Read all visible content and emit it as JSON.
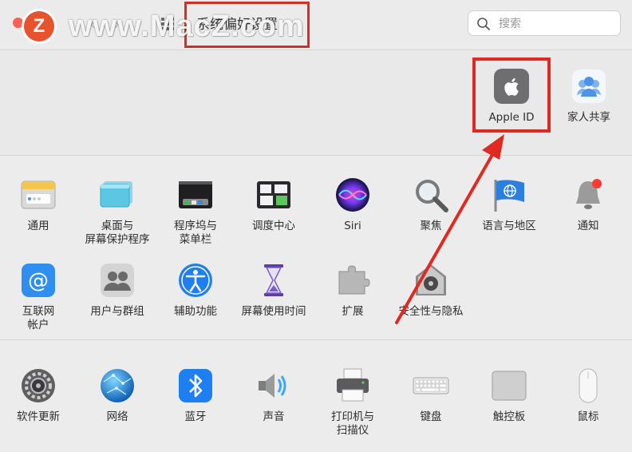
{
  "window": {
    "title": "系统偏好设置",
    "watermark": "www.MacZ.com",
    "brand_letter": "Z"
  },
  "search": {
    "placeholder": "搜索",
    "value": ""
  },
  "account": [
    {
      "id": "apple-id",
      "label": "Apple ID",
      "icon": "apple-logo-icon"
    },
    {
      "id": "family-sharing",
      "label": "家人共享",
      "icon": "family-sharing-icon"
    }
  ],
  "panes_row1": [
    {
      "id": "general",
      "label": "通用",
      "icon": "general-icon"
    },
    {
      "id": "desktop-screensaver",
      "label": "桌面与\n屏幕保护程序",
      "icon": "desktop-icon"
    },
    {
      "id": "dock-menubar",
      "label": "程序坞与\n菜单栏",
      "icon": "dock-icon"
    },
    {
      "id": "mission-control",
      "label": "调度中心",
      "icon": "mission-control-icon"
    },
    {
      "id": "siri",
      "label": "Siri",
      "icon": "siri-icon"
    },
    {
      "id": "spotlight",
      "label": "聚焦",
      "icon": "spotlight-icon"
    },
    {
      "id": "language-region",
      "label": "语言与地区",
      "icon": "flag-icon"
    },
    {
      "id": "notifications",
      "label": "通知",
      "icon": "bell-icon"
    }
  ],
  "panes_row2": [
    {
      "id": "internet-accounts",
      "label": "互联网\n帐户",
      "icon": "at-sign-icon"
    },
    {
      "id": "users-groups",
      "label": "用户与群组",
      "icon": "users-icon"
    },
    {
      "id": "accessibility",
      "label": "辅助功能",
      "icon": "accessibility-icon"
    },
    {
      "id": "screen-time",
      "label": "屏幕使用时间",
      "icon": "hourglass-icon"
    },
    {
      "id": "extensions",
      "label": "扩展",
      "icon": "puzzle-icon"
    },
    {
      "id": "security-privacy",
      "label": "安全性与隐私",
      "icon": "vault-icon"
    }
  ],
  "panes_row3": [
    {
      "id": "software-update",
      "label": "软件更新",
      "icon": "gear-icon"
    },
    {
      "id": "network",
      "label": "网络",
      "icon": "globe-icon"
    },
    {
      "id": "bluetooth",
      "label": "蓝牙",
      "icon": "bluetooth-icon"
    },
    {
      "id": "sound",
      "label": "声音",
      "icon": "speaker-icon"
    },
    {
      "id": "printers-scanners",
      "label": "打印机与\n扫描仪",
      "icon": "printer-icon"
    },
    {
      "id": "keyboard",
      "label": "键盘",
      "icon": "keyboard-icon"
    },
    {
      "id": "trackpad",
      "label": "触控板",
      "icon": "trackpad-icon"
    },
    {
      "id": "mouse",
      "label": "鼠标",
      "icon": "mouse-icon"
    }
  ],
  "colors": {
    "highlight": "#e02a21",
    "brand": "#e8522c"
  }
}
